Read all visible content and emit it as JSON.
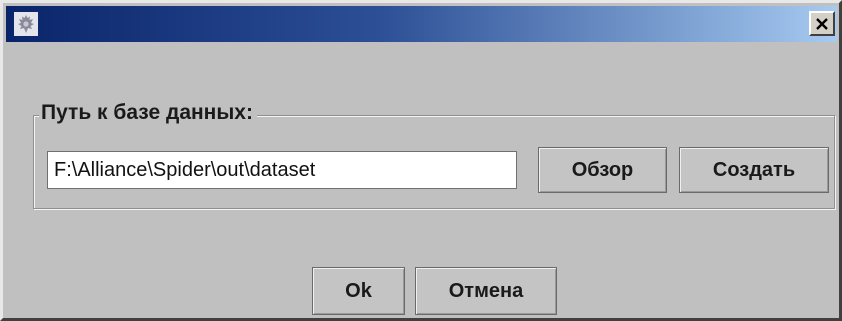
{
  "window": {
    "title": "",
    "icon": "russian-coat-of-arms-icon",
    "close_icon": "close-icon"
  },
  "database": {
    "group_label": "Путь к базе данных:",
    "path_value": "F:\\Alliance\\Spider\\out\\dataset",
    "browse_label": "Обзор",
    "create_label": "Создать"
  },
  "footer": {
    "ok_label": "Ok",
    "cancel_label": "Отмена"
  },
  "colors": {
    "title_gradient_start": "#0a246a",
    "title_gradient_end": "#a6caf0",
    "dialog_background": "#c0c0c0"
  }
}
